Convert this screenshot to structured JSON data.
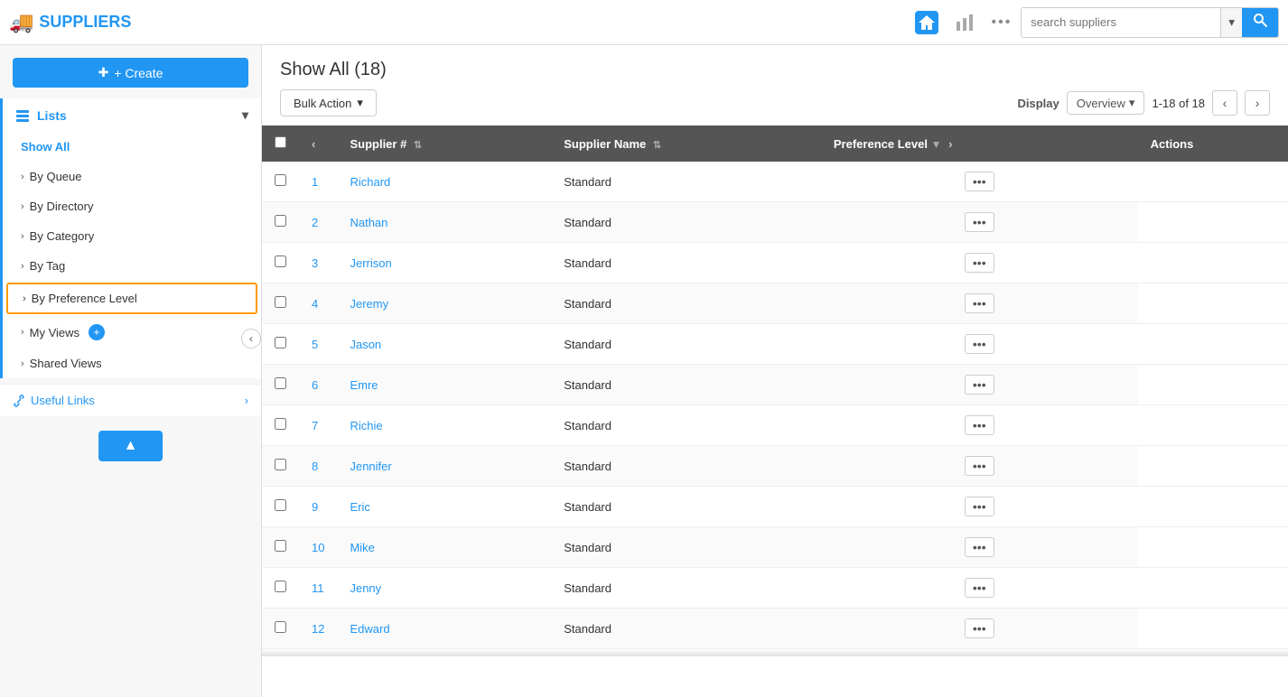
{
  "app": {
    "title": "SUPPLIERS",
    "truck_icon": "🚚"
  },
  "topbar": {
    "search_placeholder": "search suppliers",
    "home_icon": "🏠",
    "chart_icon": "📊",
    "more_icon": "•••"
  },
  "sidebar": {
    "create_label": "+ Create",
    "lists_label": "Lists",
    "show_all_label": "Show All",
    "by_queue_label": "By Queue",
    "by_directory_label": "By Directory",
    "by_category_label": "By Category",
    "by_tag_label": "By Tag",
    "by_preference_level_label": "By Preference Level",
    "my_views_label": "My Views",
    "shared_views_label": "Shared Views",
    "useful_links_label": "Useful Links",
    "scroll_top_icon": "▲"
  },
  "main": {
    "title": "Show All (18)",
    "bulk_action_label": "Bulk Action",
    "display_label": "Display",
    "display_option": "Overview",
    "page_info": "1-18 of 18"
  },
  "table": {
    "columns": [
      {
        "id": "supplier_num",
        "label": "Supplier #",
        "sortable": true
      },
      {
        "id": "supplier_name",
        "label": "Supplier Name",
        "sortable": true
      },
      {
        "id": "preference_level",
        "label": "Preference Level",
        "filterable": true
      },
      {
        "id": "actions",
        "label": "Actions"
      }
    ],
    "rows": [
      {
        "id": 1,
        "num": "1",
        "name": "Richard",
        "preference": "Standard"
      },
      {
        "id": 2,
        "num": "2",
        "name": "Nathan",
        "preference": "Standard"
      },
      {
        "id": 3,
        "num": "3",
        "name": "Jerrison",
        "preference": "Standard"
      },
      {
        "id": 4,
        "num": "4",
        "name": "Jeremy",
        "preference": "Standard"
      },
      {
        "id": 5,
        "num": "5",
        "name": "Jason",
        "preference": "Standard"
      },
      {
        "id": 6,
        "num": "6",
        "name": "Emre",
        "preference": "Standard"
      },
      {
        "id": 7,
        "num": "7",
        "name": "Richie",
        "preference": "Standard"
      },
      {
        "id": 8,
        "num": "8",
        "name": "Jennifer",
        "preference": "Standard"
      },
      {
        "id": 9,
        "num": "9",
        "name": "Eric",
        "preference": "Standard"
      },
      {
        "id": 10,
        "num": "10",
        "name": "Mike",
        "preference": "Standard"
      },
      {
        "id": 11,
        "num": "11",
        "name": "Jenny",
        "preference": "Standard"
      },
      {
        "id": 12,
        "num": "12",
        "name": "Edward",
        "preference": "Standard"
      }
    ],
    "actions_dots": "•••"
  }
}
